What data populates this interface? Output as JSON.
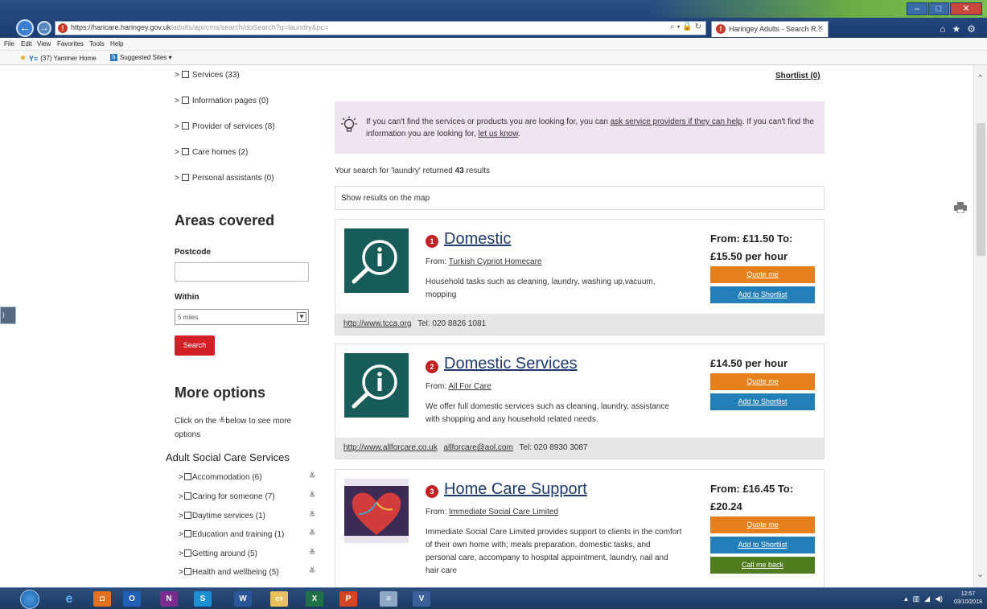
{
  "browser": {
    "url_main": "https://haricare.haringey.gov.uk",
    "url_rest": "/adults/api/cms/search/doSearch?q=laundry&pc=",
    "tab_title": "Haringey Adults - Search R...",
    "menu": [
      "File",
      "Edit",
      "View",
      "Favorites",
      "Tools",
      "Help"
    ],
    "favorites": [
      "(37) Yammer Home",
      "Suggested Sites ▾"
    ]
  },
  "filters": {
    "items": [
      "Services (33)",
      "Information pages (0)",
      "Provider of services (8)",
      "Care homes (2)",
      "Personal assistants (0)"
    ]
  },
  "areas": {
    "title": "Areas covered",
    "postcode_label": "Postcode",
    "postcode_value": "",
    "within_label": "Within",
    "within_value": "5 miles",
    "search_label": "Search"
  },
  "more_options": {
    "title": "More options",
    "hint": "Click on the ≚below to see more options",
    "section_title": "Adult Social Care Services",
    "categories": [
      "Accommodation (6)",
      "Caring for someone (7)",
      "Daytime services (1)",
      "Education and training (1)",
      "Getting around (5)",
      "Health and wellbeing (5)"
    ]
  },
  "header": {
    "shortlist": "Shortlist (0)"
  },
  "info": {
    "text_1": "If you can't find the services or products you are looking for, you can ",
    "link_1": "ask service providers if they can help",
    "text_2": ". If you can't find the information you are looking for, ",
    "link_2": "let us know",
    "text_3": "."
  },
  "results": {
    "prefix": "Your search for 'laundry' returned ",
    "count": "43",
    "suffix": " results",
    "map_link": "Show results on the map"
  },
  "cards": [
    {
      "number": "1",
      "name": "Domestic",
      "from_label": "From: ",
      "provider": "Turkish Cypriot Homecare",
      "description": "Household tasks such as cleaning, laundry, washing up,vacuum, mopping",
      "price": "From: £11.50 To: £15.50 per hour",
      "quote_label": "Quote me",
      "shortlist_label": "Add to Shortlist",
      "website": "http://www.tcca.org",
      "email": "",
      "tel": "Tel: 020 8826 1081"
    },
    {
      "number": "2",
      "name": "Domestic Services",
      "from_label": "From: ",
      "provider": "All For Care",
      "description": "We offer full domestic services such as cleaning, laundry, assistance with shopping and any household related needs.",
      "price": "£14.50 per hour",
      "quote_label": "Quote me",
      "shortlist_label": "Add to Shortlist",
      "website": "http://www.allforcare.co.uk",
      "email": "allforcare@aol.com",
      "tel": "Tel: 020 8930 3087"
    },
    {
      "number": "3",
      "name": "Home Care Support",
      "from_label": "From: ",
      "provider": "Immediate Social Care Limited",
      "description": "Immediate Social Care Limited provides support to clients in the comfort of their own home with; meals preparation, domestic tasks, and personal care, accompany to hospital appointment, laundry, nail and hair care",
      "price": "From: £16.45 To: £20.24",
      "quote_label": "Quote me",
      "shortlist_label": "Add to Shortlist",
      "callback_label": "Call me back"
    }
  ],
  "taskbar": {
    "time": "12:57",
    "date": "03/10/2018"
  },
  "colors": {
    "brand_red": "#d22027",
    "quote_orange": "#e5801a",
    "shortlist_blue": "#237fb8",
    "callback_green": "#4f7c1c",
    "info_bg": "#f1e3f1",
    "thumb_teal": "#185c5a"
  }
}
